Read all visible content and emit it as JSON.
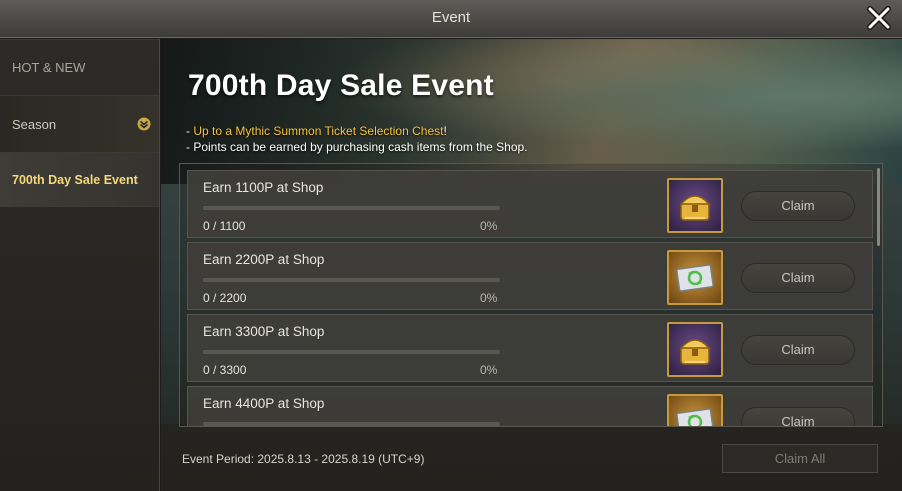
{
  "window": {
    "title": "Event",
    "close_icon": "close-icon"
  },
  "sidebar": {
    "items": [
      {
        "label": "HOT & NEW"
      },
      {
        "label": "Season",
        "icon": "chevron-down-icon"
      },
      {
        "label": "700th Day Sale Event"
      }
    ]
  },
  "banner": {
    "title": "700th Day Sale Event",
    "line1_prefix": "- ",
    "line1_highlight": "Up to a Mythic Summon Ticket Selection Chest",
    "line1_suffix": "!",
    "line2": "- Points can be earned by purchasing cash items from the Shop."
  },
  "missions": [
    {
      "label": "Earn 1100P at Shop",
      "progress": "0 / 1100",
      "percent": "0%",
      "fill": 0,
      "reward_icon": "treasure-chest-icon",
      "claim": "Claim"
    },
    {
      "label": "Earn 2200P at Shop",
      "progress": "0 / 2200",
      "percent": "0%",
      "fill": 0,
      "reward_icon": "summon-ticket-icon",
      "claim": "Claim"
    },
    {
      "label": "Earn 3300P at Shop",
      "progress": "0 / 3300",
      "percent": "0%",
      "fill": 0,
      "reward_icon": "treasure-chest-icon",
      "claim": "Claim"
    },
    {
      "label": "Earn 4400P at Shop",
      "reward_icon": "summon-ticket-icon",
      "claim": "Claim"
    }
  ],
  "footer": {
    "period": "Event Period: 2025.8.13 - 2025.8.19 (UTC+9)",
    "claim_all": "Claim All"
  },
  "colors": {
    "highlight": "#f3c13f",
    "active_tab": "#f5d97b",
    "progress_fill": "#e1b53e"
  }
}
